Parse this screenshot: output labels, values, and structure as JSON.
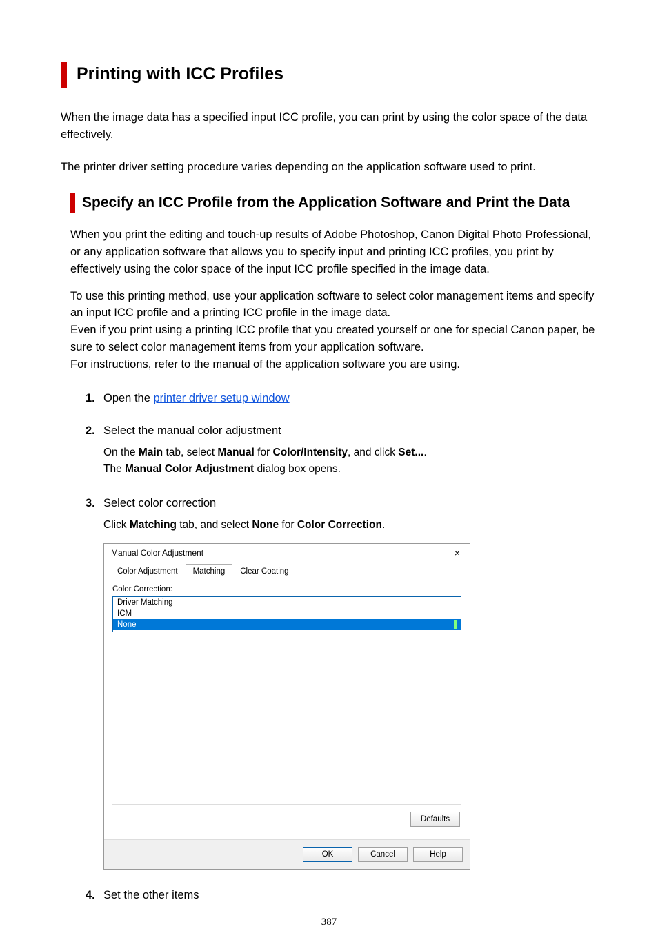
{
  "page_title": "Printing with ICC Profiles",
  "intro_p1": "When the image data has a specified input ICC profile, you can print by using the color space of the data effectively.",
  "intro_p2": "The printer driver setting procedure varies depending on the application software used to print.",
  "section": {
    "heading": "Specify an ICC Profile from the Application Software and Print the Data",
    "p1": "When you print the editing and touch-up results of Adobe Photoshop, Canon Digital Photo Professional, or any application software that allows you to specify input and printing ICC profiles, you print by effectively using the color space of the input ICC profile specified in the image data.",
    "p2a": "To use this printing method, use your application software to select color management items and specify an input ICC profile and a printing ICC profile in the image data.",
    "p2b": "Even if you print using a printing ICC profile that you created yourself or one for special Canon paper, be sure to select color management items from your application software.",
    "p2c": "For instructions, refer to the manual of the application software you are using."
  },
  "steps": {
    "s1": {
      "num": "1.",
      "prefix": "Open the ",
      "link": "printer driver setup window"
    },
    "s2": {
      "num": "2.",
      "title": "Select the manual color adjustment",
      "body_parts": {
        "a": "On the ",
        "main": "Main",
        "b": " tab, select ",
        "manual": "Manual",
        "c": " for ",
        "ci": "Color/Intensity",
        "d": ", and click ",
        "set": "Set...",
        "e": ".",
        "line2a": "The ",
        "mca": "Manual Color Adjustment",
        "line2b": " dialog box opens."
      }
    },
    "s3": {
      "num": "3.",
      "title": "Select color correction",
      "body_parts": {
        "a": "Click ",
        "matching": "Matching",
        "b": " tab, and select ",
        "none": "None",
        "c": " for ",
        "cc": "Color Correction",
        "d": "."
      }
    },
    "s4": {
      "num": "4.",
      "title": "Set the other items"
    }
  },
  "dialog": {
    "title": "Manual Color Adjustment",
    "close": "×",
    "tabs": [
      "Color Adjustment",
      "Matching",
      "Clear Coating"
    ],
    "label": "Color Correction:",
    "options": [
      "Driver Matching",
      "ICM",
      "None"
    ],
    "defaults": "Defaults",
    "ok": "OK",
    "cancel": "Cancel",
    "help": "Help"
  },
  "page_number": "387"
}
